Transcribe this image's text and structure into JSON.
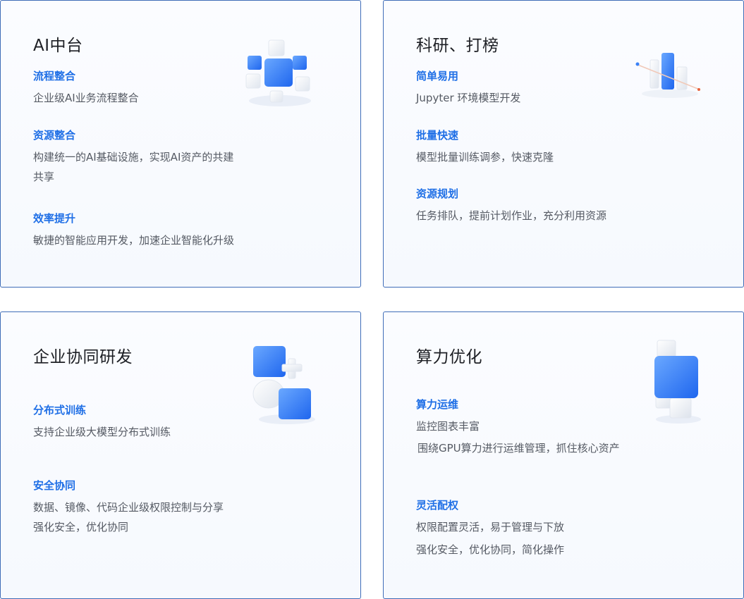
{
  "cards": [
    {
      "title": "AI中台",
      "features": [
        {
          "title": "流程整合",
          "lines": [
            "企业级AI业务流程整合"
          ]
        },
        {
          "title": "资源整合",
          "lines": [
            "构建统一的AI基础设施，实现AI资产的共建",
            "共享"
          ]
        },
        {
          "title": "效率提升",
          "lines": [
            "敏捷的智能应用开发，加速企业智能化升级"
          ]
        }
      ]
    },
    {
      "title": "科研、打榜",
      "features": [
        {
          "title": "简单易用",
          "lines": [
            "Jupyter 环境模型开发"
          ]
        },
        {
          "title": "批量快速",
          "lines": [
            "模型批量训练调参，快速克隆"
          ]
        },
        {
          "title": "资源规划",
          "lines": [
            "任务排队，提前计划作业，充分利用资源"
          ]
        }
      ]
    },
    {
      "title": "企业协同研发",
      "features": [
        {
          "title": "分布式训练",
          "lines": [
            "支持企业级大模型分布式训练"
          ]
        },
        {
          "title": "安全协同",
          "lines": [
            "数据、镜像、代码企业级权限控制与分享",
            "强化安全，优化协同"
          ]
        }
      ]
    },
    {
      "title": "算力优化",
      "features": [
        {
          "title": "算力运维",
          "lines": [
            "监控图表丰富",
            "围绕GPU算力进行运维管理，抓住核心资产"
          ]
        },
        {
          "title": "灵活配权",
          "lines": [
            "权限配置灵活，易于管理与下放",
            "强化安全，优化协同，简化操作"
          ]
        }
      ]
    }
  ],
  "colors": {
    "border": "#3f6db8",
    "title": "#1d1f24",
    "feature_title": "#1f6fe6",
    "feature_text": "#555a63",
    "cube_blue": "#3b82f6"
  },
  "icons": [
    "cube-cluster-icon",
    "bar-chart-rocket-icon",
    "cube-cross-icon",
    "stacked-cube-icon"
  ]
}
